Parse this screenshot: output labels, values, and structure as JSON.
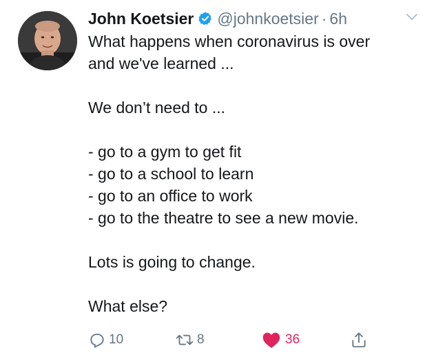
{
  "tweet": {
    "display_name": "John Koetsier",
    "handle": "@johnkoetsier",
    "separator": "·",
    "time": "6h",
    "lines": [
      "What happens when coronavirus is over",
      "and we've learned ...",
      "",
      "We don’t need to ...",
      "",
      "- go to a gym to get fit",
      "- go to a school to learn",
      "- go to an office to work",
      "- go to the theatre to see a new movie.",
      "",
      "Lots is going to change.",
      "",
      "What else?"
    ]
  },
  "actions": {
    "reply_count": "10",
    "retweet_count": "8",
    "like_count": "36"
  },
  "colors": {
    "verified": "#1da1f2",
    "like": "#e0245e",
    "muted": "#657786"
  },
  "icons": {
    "verified": "verified-badge-icon",
    "more": "chevron-down-icon",
    "reply": "reply-icon",
    "retweet": "retweet-icon",
    "like": "heart-icon",
    "share": "share-icon"
  }
}
